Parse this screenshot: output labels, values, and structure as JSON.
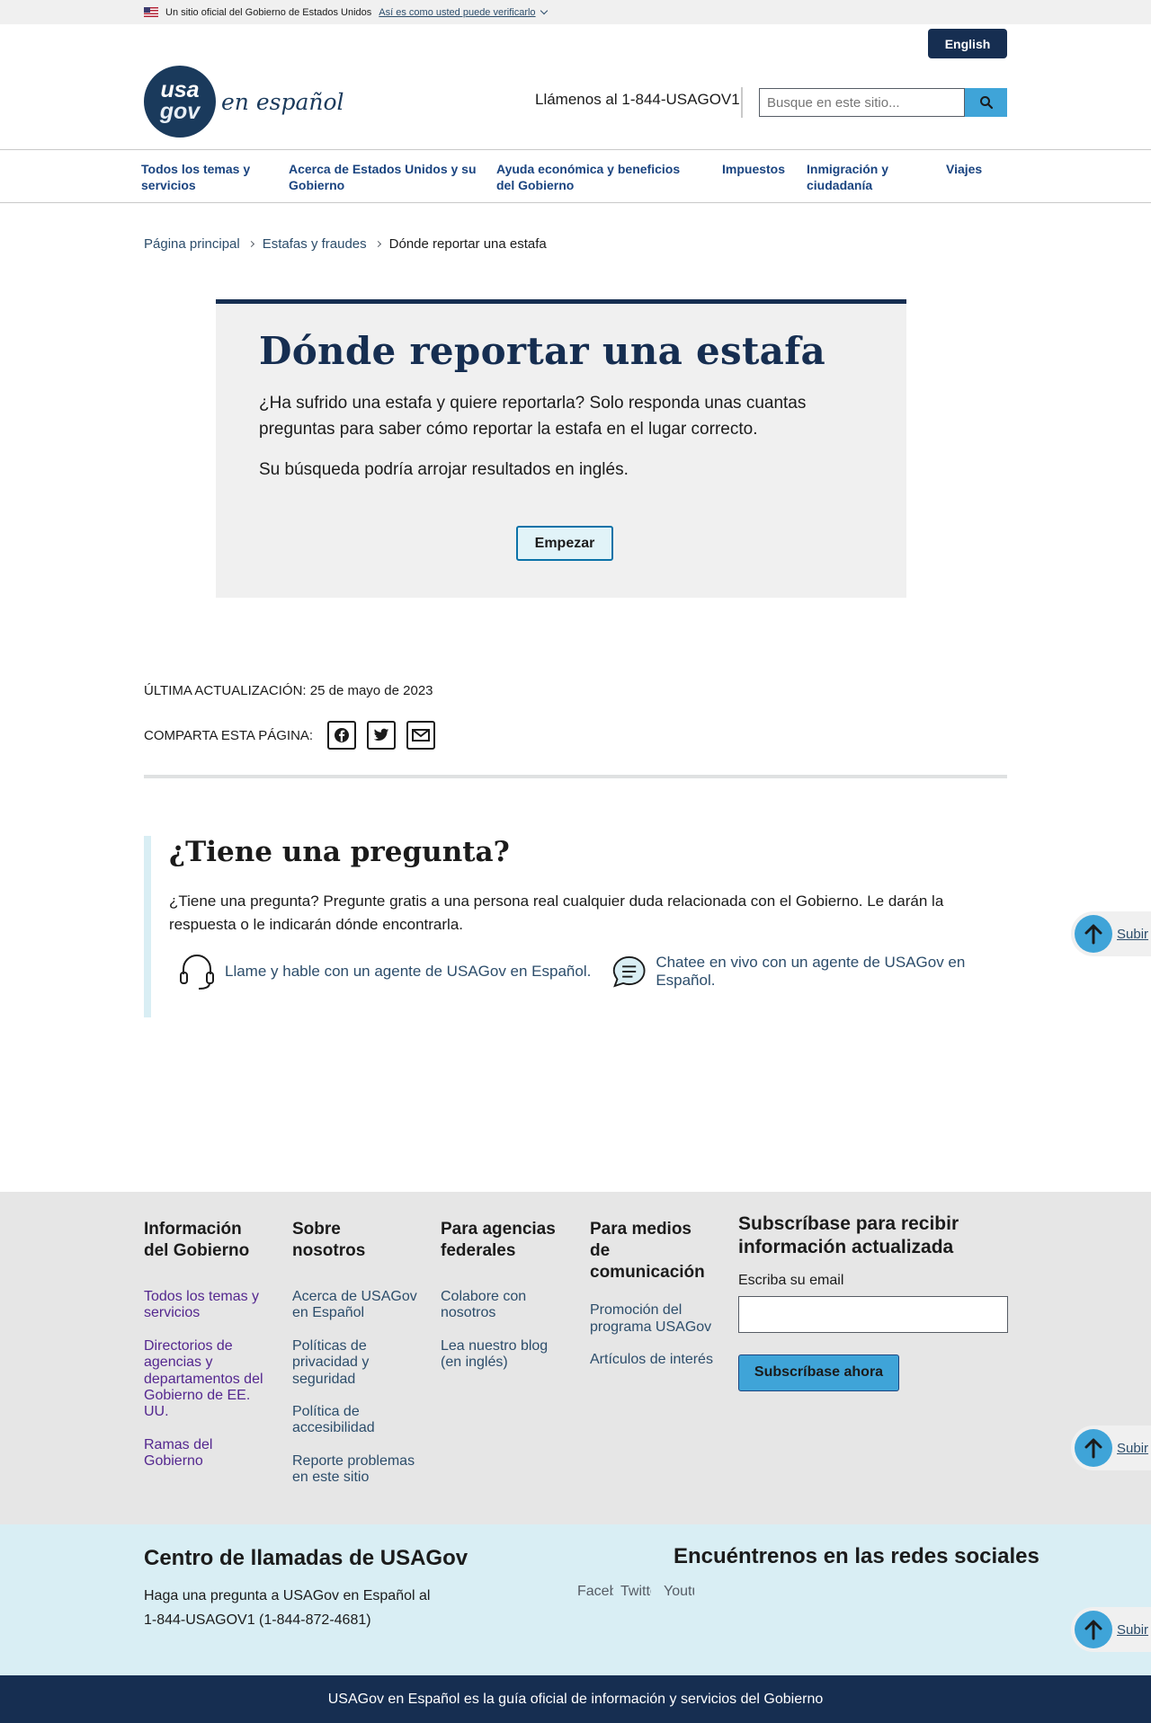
{
  "banner": {
    "text": "Un sitio oficial del Gobierno de Estados Unidos",
    "verify_link": "Así es como usted puede verificarlo"
  },
  "header": {
    "language_button": "English",
    "logo_top": "usa",
    "logo_bottom": "gov",
    "logo_text": "en español",
    "call": "Llámenos al 1-844-USAGOV1",
    "search_placeholder": "Busque en este sitio..."
  },
  "nav": {
    "items": [
      {
        "label": "Todos los temas y servicios"
      },
      {
        "label": "Acerca de Estados Unidos y su Gobierno"
      },
      {
        "label": "Ayuda económica y beneficios del Gobierno"
      },
      {
        "label": "Impuestos"
      },
      {
        "label": "Inmigración y ciudadanía"
      },
      {
        "label": "Viajes"
      }
    ]
  },
  "breadcrumb": {
    "home": "Página principal",
    "section": "Estafas y fraudes",
    "current": "Dónde reportar una estafa"
  },
  "hero": {
    "title": "Dónde reportar una estafa",
    "intro": "¿Ha sufrido una estafa y quiere reportarla? Solo responda unas cuantas preguntas para saber cómo reportar la estafa en el lugar correcto.",
    "note": "Su búsqueda podría arrojar resultados en inglés.",
    "start_button": "Empezar"
  },
  "updated": "ÚLTIMA ACTUALIZACIÓN: 25 de mayo de 2023",
  "share": {
    "label": "COMPARTA ESTA PÁGINA:"
  },
  "question": {
    "title": "¿Tiene una pregunta?",
    "text": "¿Tiene una pregunta? Pregunte gratis a una persona real cualquier duda relacionada con el Gobierno. Le darán la respuesta o le indicarán dónde encontrarla.",
    "call_link": "Llame y hable con un agente de USAGov en Español.",
    "chat_link": "Chatee en vivo con un agente de USAGov en Español."
  },
  "subir": "Subir",
  "footer": {
    "columns": [
      {
        "title": "Información del Gobierno",
        "links": [
          "Todos los temas y servicios",
          "Directorios de agencias y departamentos del Gobierno de EE. UU.",
          "Ramas del Gobierno"
        ]
      },
      {
        "title": "Sobre nosotros",
        "links": [
          "Acerca de USAGov en Español",
          "Políticas de privacidad y seguridad",
          "Política de accesibilidad",
          "Reporte problemas en este sitio"
        ]
      },
      {
        "title": "Para agencias federales",
        "links": [
          "Colabore con nosotros",
          "Lea nuestro blog (en inglés)"
        ]
      },
      {
        "title": "Para medios de comunicación",
        "links": [
          "Promoción del programa USAGov",
          "Artículos de interés"
        ]
      }
    ],
    "subscribe": {
      "title": "Subscríbase para recibir información actualizada",
      "label": "Escriba su email",
      "button": "Subscríbase ahora"
    }
  },
  "callcenter": {
    "title": "Centro de llamadas de USAGov",
    "text": "Haga una pregunta a USAGov en Español al 1-844-USAGOV1 (1-844-872-4681)",
    "social_title": "Encuéntrenos en las redes sociales",
    "social": [
      "Facebook",
      "Twitter",
      "Youtube"
    ]
  },
  "bottom": "USAGov en Español es la guía oficial de información y servicios del Gobierno",
  "colors": {
    "navy": "#162e51",
    "accent": "#3fa4d8",
    "light_blue": "#d9eef4",
    "gray_bg": "#f0f0f0"
  }
}
